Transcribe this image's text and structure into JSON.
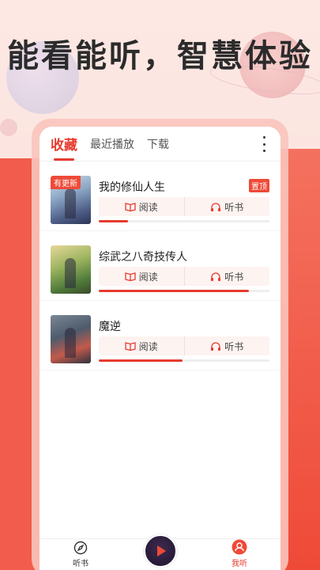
{
  "slogan": "能看能听，智慧体验",
  "tabs": [
    {
      "label": "收藏",
      "active": true
    },
    {
      "label": "最近播放",
      "active": false
    },
    {
      "label": "下载",
      "active": false
    }
  ],
  "more_icon": "more-vertical-icon",
  "read_label": "阅读",
  "listen_label": "听书",
  "books": [
    {
      "title": "我的修仙人生",
      "update_badge": "有更新",
      "top_badge": "置顶",
      "progress": 0.17
    },
    {
      "title": "综武之八奇技传人",
      "update_badge": "",
      "top_badge": "",
      "progress": 0.88
    },
    {
      "title": "魔逆",
      "update_badge": "",
      "top_badge": "",
      "progress": 0.49
    }
  ],
  "nav": {
    "left_label": "听书",
    "right_label": "我听"
  },
  "colors": {
    "accent": "#e63b2e",
    "background": "#fbe3dd",
    "side_red": "#ef4a38"
  }
}
